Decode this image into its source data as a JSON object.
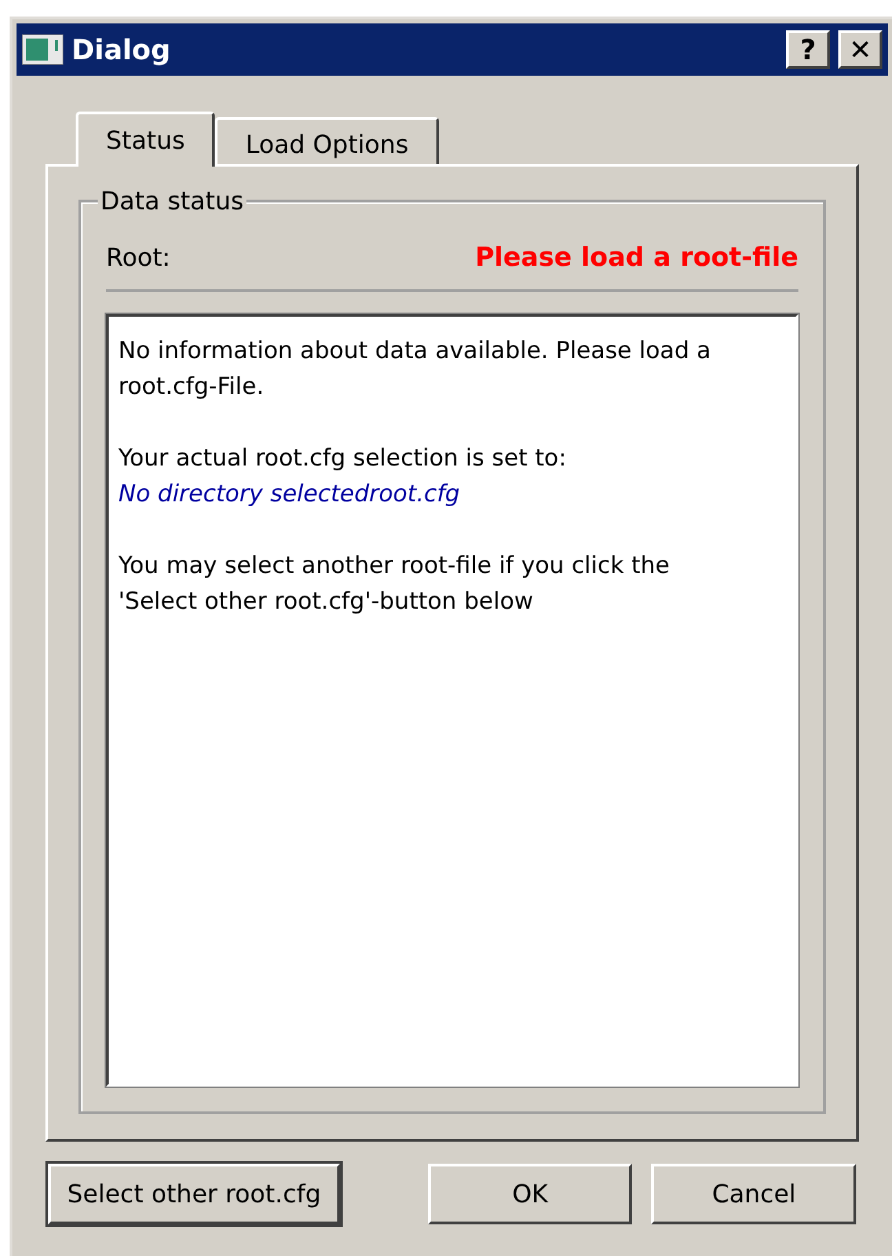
{
  "window": {
    "title": "Dialog",
    "title_buttons": [
      "?",
      "✕"
    ]
  },
  "tabs": [
    {
      "label": "Status",
      "selected": true
    },
    {
      "label": "Load Options",
      "selected": false
    }
  ],
  "group": {
    "title": "Data status",
    "root_label": "Root:",
    "root_status": "Please load a root-file"
  },
  "info": [
    {
      "kind": "text",
      "text": "No information about data available. Please load a root.cfg-File."
    },
    {
      "kind": "text",
      "text": "Your actual root.cfg selection is set to:"
    },
    {
      "kind": "path",
      "text": "No directory selectedroot.cfg"
    },
    {
      "kind": "text",
      "text": "You may select another root-file if you click the 'Select other root.cfg'-button below"
    }
  ],
  "buttons": [
    {
      "label": "Select other root.cfg",
      "default": true
    },
    {
      "label": "OK",
      "default": false
    },
    {
      "label": "Cancel",
      "default": false
    }
  ]
}
